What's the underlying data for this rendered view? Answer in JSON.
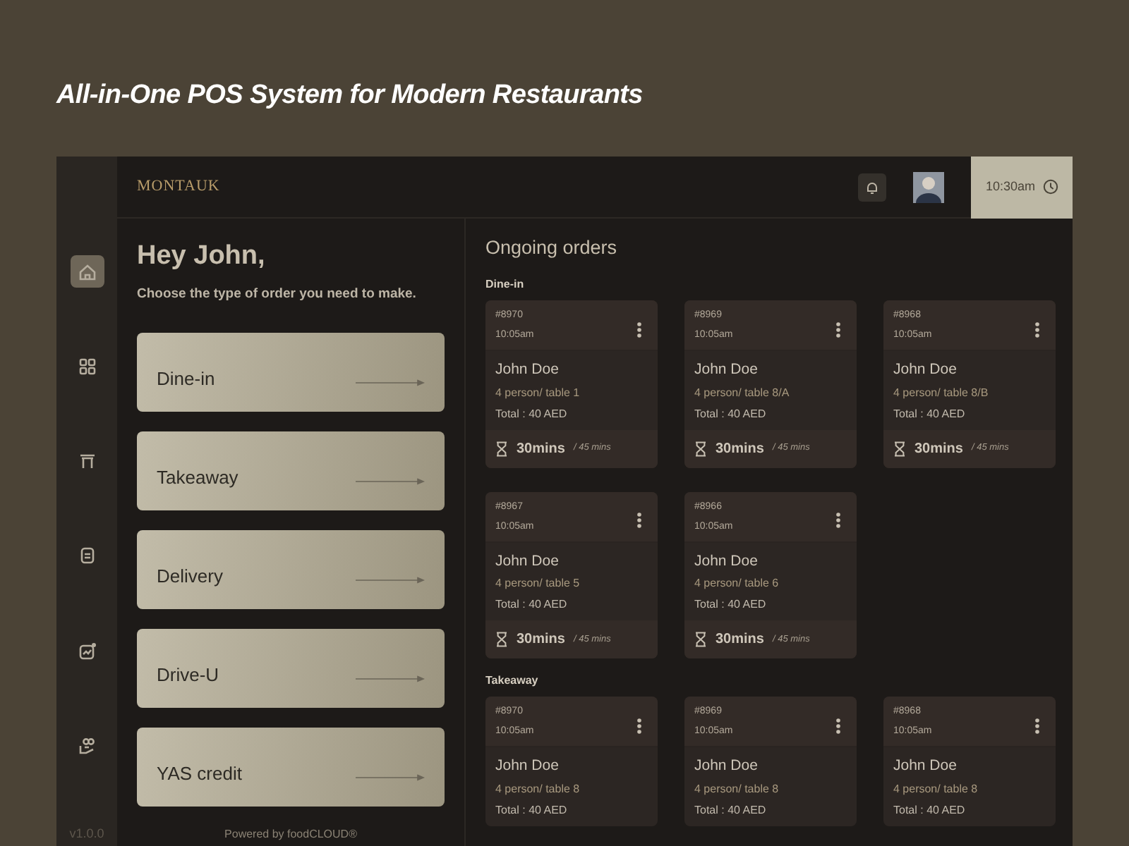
{
  "headline": "All-in-One POS System for Modern Restaurants",
  "header": {
    "logo": "MONTAUK",
    "time": "10:30am"
  },
  "sidebar": {
    "items": [
      {
        "selected": true
      },
      {
        "selected": false
      },
      {
        "selected": false
      },
      {
        "selected": false
      },
      {
        "selected": false
      },
      {
        "selected": false
      }
    ],
    "version": "v1.0.0"
  },
  "greeting": {
    "title": "Hey John,",
    "subtitle": "Choose the type of order you need to make."
  },
  "order_types": [
    "Dine-in",
    "Takeaway",
    "Delivery",
    "Drive-U",
    "YAS credit"
  ],
  "footer": "Powered by foodCLOUD®",
  "ongoing": {
    "title": "Ongoing orders",
    "sections": [
      {
        "title": "Dine-in",
        "orders": [
          {
            "number": "#8970",
            "time": "10:05am",
            "name": "John Doe",
            "details": "4 person/ table 1",
            "total": "Total : 40 AED",
            "elapsed": "30mins",
            "limit": "/ 45 mins"
          },
          {
            "number": "#8969",
            "time": "10:05am",
            "name": "John Doe",
            "details": "4 person/ table 8/A",
            "total": "Total : 40 AED",
            "elapsed": "30mins",
            "limit": "/ 45 mins"
          },
          {
            "number": "#8968",
            "time": "10:05am",
            "name": "John Doe",
            "details": "4 person/ table 8/B",
            "total": "Total : 40 AED",
            "elapsed": "30mins",
            "limit": "/ 45 mins"
          },
          {
            "number": "#8967",
            "time": "10:05am",
            "name": "John Doe",
            "details": "4 person/ table 5",
            "total": "Total : 40 AED",
            "elapsed": "30mins",
            "limit": "/ 45 mins"
          },
          {
            "number": "#8966",
            "time": "10:05am",
            "name": "John Doe",
            "details": "4 person/ table 6",
            "total": "Total : 40 AED",
            "elapsed": "30mins",
            "limit": "/ 45 mins"
          }
        ]
      },
      {
        "title": "Takeaway",
        "orders": [
          {
            "number": "#8970",
            "time": "10:05am",
            "name": "John Doe",
            "details": "4 person/ table 8",
            "total": "Total : 40 AED"
          },
          {
            "number": "#8969",
            "time": "10:05am",
            "name": "John Doe",
            "details": "4 person/ table 8",
            "total": "Total : 40 AED"
          },
          {
            "number": "#8968",
            "time": "10:05am",
            "name": "John Doe",
            "details": "4 person/ table 8",
            "total": "Total : 40 AED"
          }
        ]
      }
    ]
  }
}
